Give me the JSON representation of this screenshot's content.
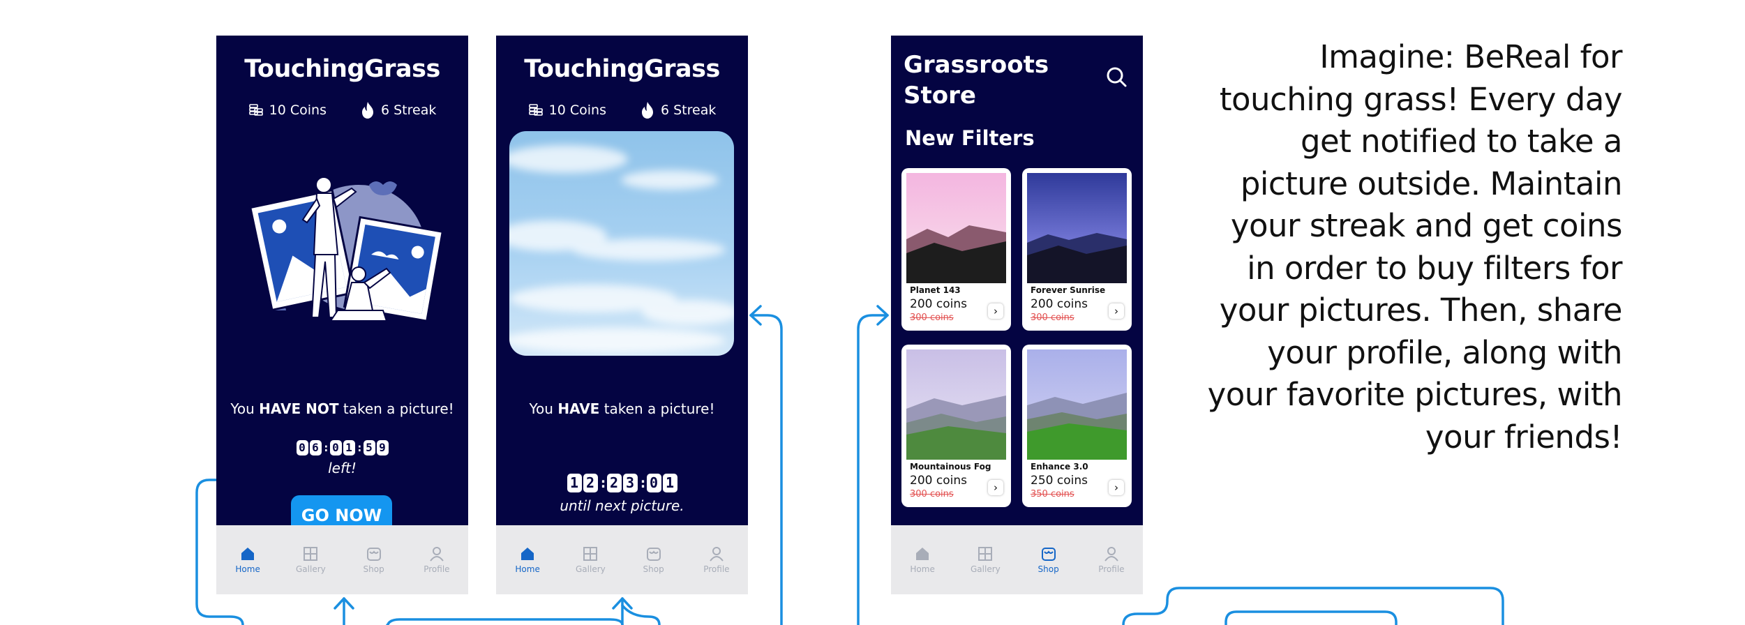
{
  "colors": {
    "phone_bg": "#040442",
    "accent": "#1496f0",
    "tabbar_bg": "#e9e9eb",
    "tab_active": "#1566c7",
    "tab_inactive": "#a8adb8",
    "connector": "#1a8fe0",
    "old_price": "#e25050"
  },
  "screen_home_pending": {
    "app_title": "TouchingGrass",
    "coins": "10 Coins",
    "coins_icon": "coins-stack-icon",
    "streak": "6 Streak",
    "streak_icon": "flame-icon",
    "illustration": "selfie-illustration",
    "message": {
      "prefix": "You ",
      "emphasis": "HAVE NOT",
      "suffix": " taken a picture!"
    },
    "countdown": {
      "h1": "0",
      "h2": "6",
      "m1": "0",
      "m2": "1",
      "s1": "5",
      "s2": "9"
    },
    "countdown_caption": "left!",
    "go_button": "GO NOW"
  },
  "screen_home_done": {
    "app_title": "TouchingGrass",
    "coins": "10 Coins",
    "streak": "6 Streak",
    "photo": "sky-photo",
    "message": {
      "prefix": "You ",
      "emphasis": "HAVE",
      "suffix": " taken a picture!"
    },
    "countdown": {
      "h1": "1",
      "h2": "2",
      "m1": "2",
      "m2": "3",
      "s1": "0",
      "s2": "1"
    },
    "countdown_caption": "until next picture."
  },
  "screen_store": {
    "title_line1": "Grassroots",
    "title_line2": "Store",
    "search_icon": "search-icon",
    "section_title": "New Filters",
    "filters": [
      {
        "name": "Planet 143",
        "price": "200 coins",
        "old_price": "300 coins"
      },
      {
        "name": "Forever Sunrise",
        "price": "200 coins",
        "old_price": "300 coins"
      },
      {
        "name": "Mountainous Fog",
        "price": "200 coins",
        "old_price": "300 coins"
      },
      {
        "name": "Enhance 3.0",
        "price": "250 coins",
        "old_price": "350 coins"
      }
    ],
    "card_arrow": "›"
  },
  "tabbar": {
    "home": "Home",
    "gallery": "Gallery",
    "shop": "Shop",
    "profile": "Profile"
  },
  "description": "Imagine: BeReal for touching grass! Every day get notified to take a picture outside. Maintain your streak and get coins in order to buy filters for your pictures. Then, share your profile, along with your favorite pictures, with your friends!"
}
